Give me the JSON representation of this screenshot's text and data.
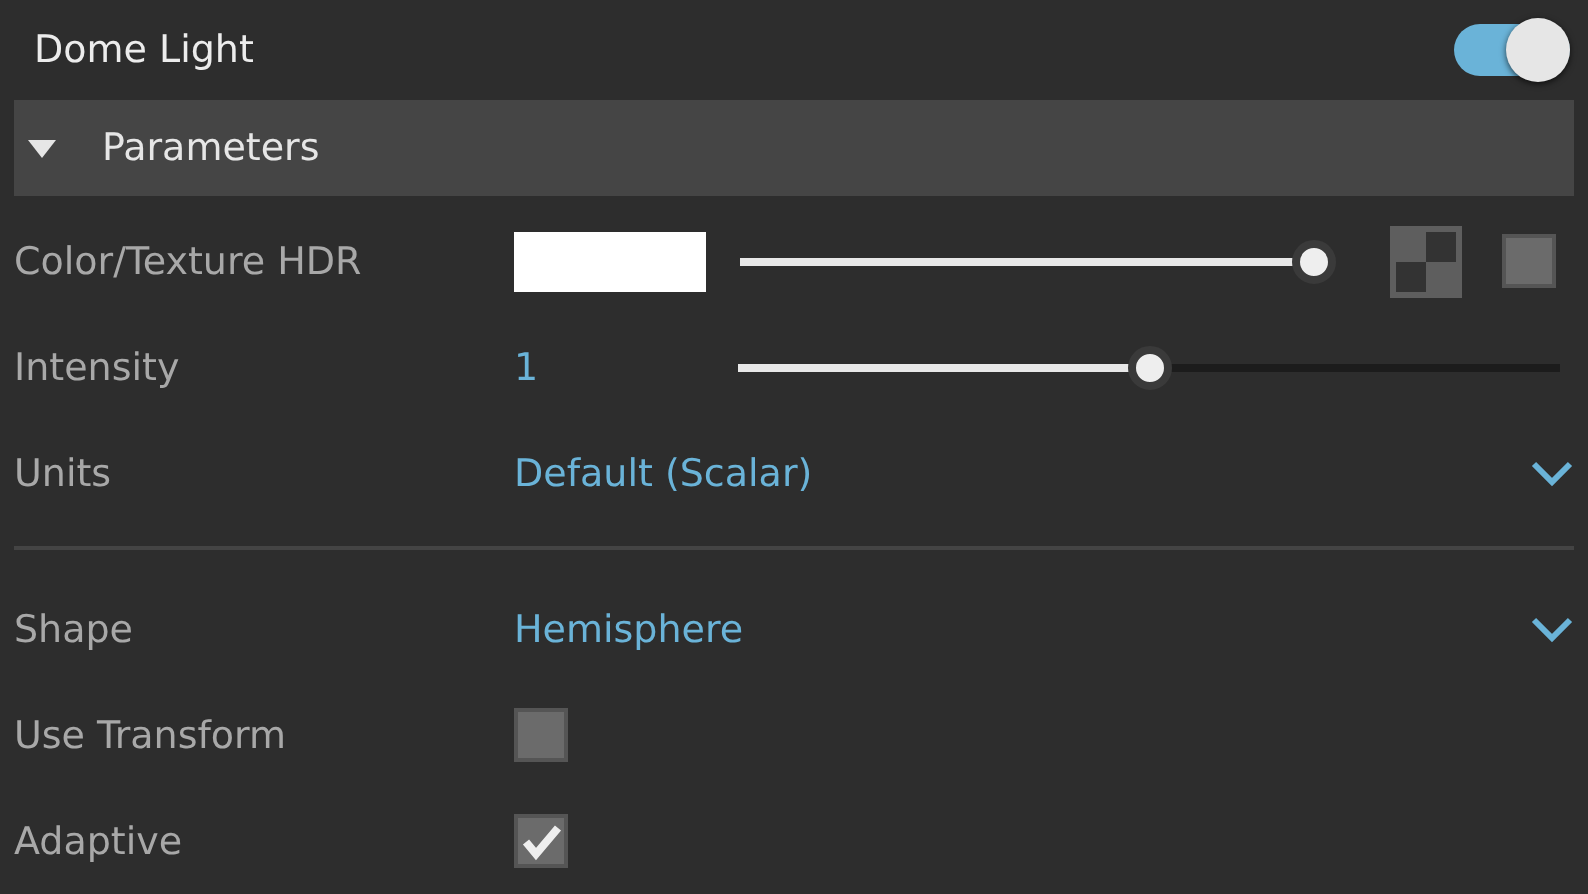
{
  "header": {
    "title": "Dome Light",
    "on": true
  },
  "section": {
    "title": "Parameters",
    "expanded": true
  },
  "rows": [
    {
      "kind": "color",
      "label": "Color/Texture HDR",
      "color": "#ffffff",
      "level": 0.97
    },
    {
      "kind": "slider",
      "label": "Intensity",
      "value": "1",
      "level": 0.5
    },
    {
      "kind": "dropdown",
      "label": "Units",
      "value": "Default (Scalar)"
    },
    {
      "kind": "divider"
    },
    {
      "kind": "dropdown",
      "label": "Shape",
      "value": "Hemisphere"
    },
    {
      "kind": "checkbox",
      "label": "Use Transform",
      "checked": false
    },
    {
      "kind": "checkbox",
      "label": "Adaptive",
      "checked": true
    }
  ]
}
